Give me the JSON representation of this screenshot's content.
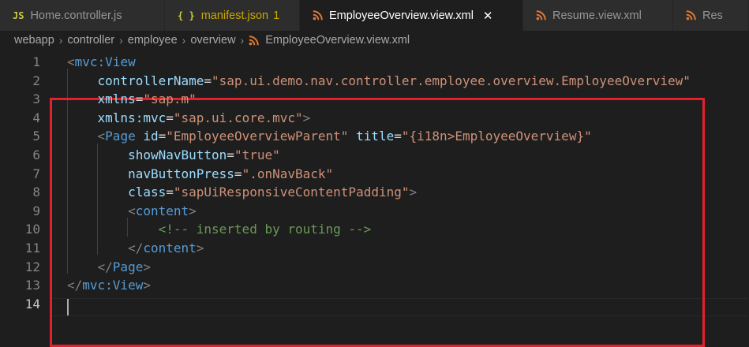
{
  "tabs": [
    {
      "icon": "JS",
      "label": "Home.controller.js",
      "badge": "",
      "active": false
    },
    {
      "icon": "{ }",
      "label": "manifest.json",
      "badge": "1",
      "active": false
    },
    {
      "icon": "rss",
      "label": "EmployeeOverview.view.xml",
      "badge": "",
      "active": true
    },
    {
      "icon": "rss",
      "label": "Resume.view.xml",
      "badge": "",
      "active": false
    },
    {
      "icon": "rss",
      "label": "Res",
      "badge": "",
      "active": false
    }
  ],
  "tab_close_glyph": "✕",
  "breadcrumb": [
    "webapp",
    "controller",
    "employee",
    "overview",
    "EmployeeOverview.view.xml"
  ],
  "editor": {
    "current_line": 14,
    "lines": [
      {
        "num": "1",
        "indent": "",
        "tokens": [
          [
            "punc",
            "<"
          ],
          [
            "tag",
            "mvc:View"
          ]
        ]
      },
      {
        "num": "2",
        "indent": "    ",
        "tokens": [
          [
            "attr",
            "controllerName"
          ],
          [
            "eq",
            "="
          ],
          [
            "str",
            "\"sap.ui.demo.nav.controller.employee.overview.EmployeeOverview\""
          ]
        ]
      },
      {
        "num": "3",
        "indent": "    ",
        "tokens": [
          [
            "attr",
            "xmlns"
          ],
          [
            "eq",
            "="
          ],
          [
            "str",
            "\"sap.m\""
          ]
        ]
      },
      {
        "num": "4",
        "indent": "    ",
        "tokens": [
          [
            "attr",
            "xmlns:mvc"
          ],
          [
            "eq",
            "="
          ],
          [
            "str",
            "\"sap.ui.core.mvc\""
          ],
          [
            "punc",
            ">"
          ]
        ]
      },
      {
        "num": "5",
        "indent": "    ",
        "tokens": [
          [
            "punc",
            "<"
          ],
          [
            "tag",
            "Page"
          ],
          [
            "eq",
            " "
          ],
          [
            "attr",
            "id"
          ],
          [
            "eq",
            "="
          ],
          [
            "str",
            "\"EmployeeOverviewParent\""
          ],
          [
            "eq",
            " "
          ],
          [
            "attr",
            "title"
          ],
          [
            "eq",
            "="
          ],
          [
            "str",
            "\"{i18n>EmployeeOverview}\""
          ]
        ]
      },
      {
        "num": "6",
        "indent": "        ",
        "tokens": [
          [
            "attr",
            "showNavButton"
          ],
          [
            "eq",
            "="
          ],
          [
            "str",
            "\"true\""
          ]
        ]
      },
      {
        "num": "7",
        "indent": "        ",
        "tokens": [
          [
            "attr",
            "navButtonPress"
          ],
          [
            "eq",
            "="
          ],
          [
            "str",
            "\".onNavBack\""
          ]
        ]
      },
      {
        "num": "8",
        "indent": "        ",
        "tokens": [
          [
            "attr",
            "class"
          ],
          [
            "eq",
            "="
          ],
          [
            "str",
            "\"sapUiResponsiveContentPadding\""
          ],
          [
            "punc",
            ">"
          ]
        ]
      },
      {
        "num": "9",
        "indent": "        ",
        "tokens": [
          [
            "punc",
            "<"
          ],
          [
            "tag",
            "content"
          ],
          [
            "punc",
            ">"
          ]
        ]
      },
      {
        "num": "10",
        "indent": "            ",
        "tokens": [
          [
            "com",
            "<!-- inserted by routing -->"
          ]
        ]
      },
      {
        "num": "11",
        "indent": "        ",
        "tokens": [
          [
            "punc",
            "</"
          ],
          [
            "tag",
            "content"
          ],
          [
            "punc",
            ">"
          ]
        ]
      },
      {
        "num": "12",
        "indent": "    ",
        "tokens": [
          [
            "punc",
            "</"
          ],
          [
            "tag",
            "Page"
          ],
          [
            "punc",
            ">"
          ]
        ]
      },
      {
        "num": "13",
        "indent": "",
        "tokens": [
          [
            "punc",
            "</"
          ],
          [
            "tag",
            "mvc:View"
          ],
          [
            "punc",
            ">"
          ]
        ]
      },
      {
        "num": "14",
        "indent": "",
        "tokens": []
      }
    ]
  },
  "colors": {
    "js_icon": "#cbcb41",
    "json_icon": "#cbcb41",
    "xml_icon": "#e37933",
    "highlight_border": "#e5202e"
  }
}
